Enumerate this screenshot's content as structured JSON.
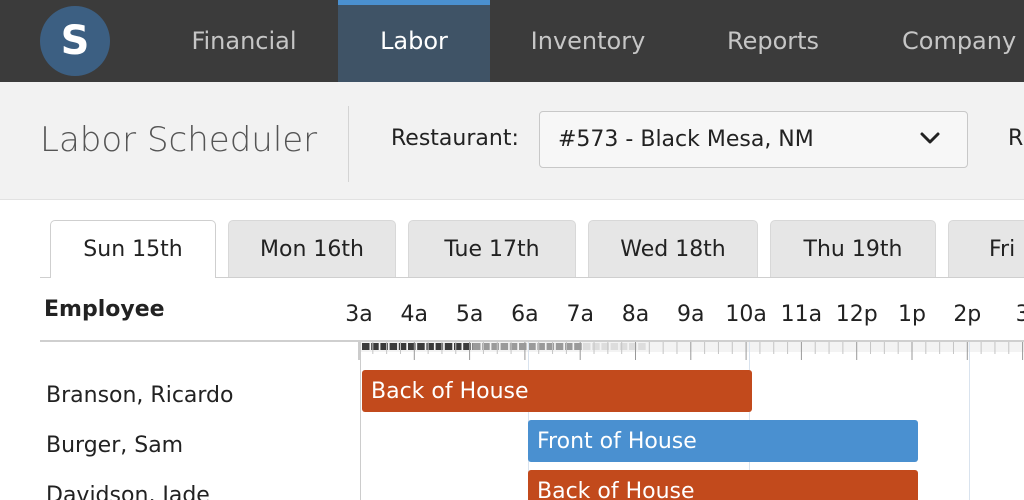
{
  "nav": {
    "logo": "S",
    "items": [
      {
        "label": "Financial",
        "active": false
      },
      {
        "label": "Labor",
        "active": true
      },
      {
        "label": "Inventory",
        "active": false
      },
      {
        "label": "Reports",
        "active": false
      },
      {
        "label": "Company",
        "active": false
      }
    ]
  },
  "header": {
    "title": "Labor Scheduler",
    "restaurant_label": "Restaurant:",
    "restaurant_value": "#573 - Black Mesa, NM",
    "next_label_partial": "R"
  },
  "days": [
    {
      "label": "Sun 15th",
      "active": true
    },
    {
      "label": "Mon 16th",
      "active": false
    },
    {
      "label": "Tue 17th",
      "active": false
    },
    {
      "label": "Wed 18th",
      "active": false
    },
    {
      "label": "Thu 19th",
      "active": false
    },
    {
      "label": "Fri",
      "active": false
    }
  ],
  "grid": {
    "employee_header": "Employee",
    "hours": [
      "3a",
      "4a",
      "5a",
      "6a",
      "7a",
      "8a",
      "9a",
      "10a",
      "11a",
      "12p",
      "1p",
      "2p",
      "3"
    ]
  },
  "employees": [
    {
      "name": "Branson, Ricardo",
      "shift": {
        "label": "Back of House",
        "start": "3a",
        "end": "10a"
      }
    },
    {
      "name": "Burger, Sam",
      "shift": {
        "label": "Front of House",
        "start": "6a",
        "end": "1p"
      }
    },
    {
      "name": "Davidson, Jade",
      "shift": {
        "label": "Back of House",
        "start": "6a",
        "end": "1p"
      }
    }
  ],
  "colors": {
    "nav_bg": "#3b3b3b",
    "nav_active_bg": "#3f5366",
    "nav_active_accent": "#4a90d0",
    "back_of_house": "#c24a1c",
    "front_of_house": "#4a90d0"
  }
}
